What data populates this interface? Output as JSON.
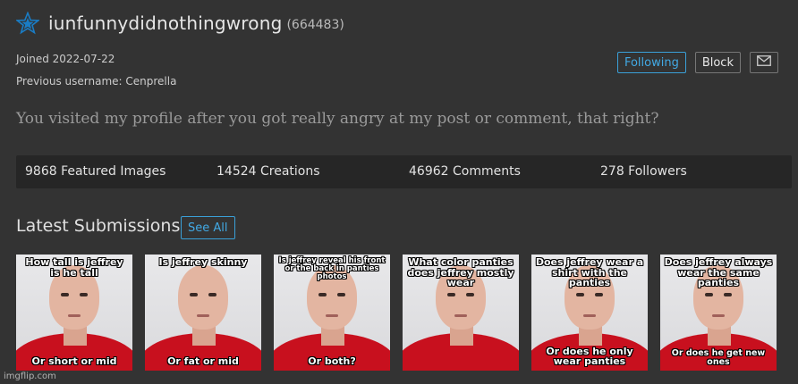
{
  "profile": {
    "username": "iunfunnydidnothingwrong",
    "user_id": "(664483)",
    "joined": "Joined 2022-07-22",
    "previous_username": "Previous username: Cenprella",
    "bio": "You visited my profile after you got really angry at my post or comment, that right?",
    "star_icon": "star-icon",
    "star_color": "#1a7cc4"
  },
  "actions": {
    "following_label": "Following",
    "block_label": "Block",
    "message_icon": "envelope-icon",
    "accent_color": "#42a9e4"
  },
  "stats": {
    "featured": "9868 Featured Images",
    "creations": "14524 Creations",
    "comments": "46962 Comments",
    "followers": "278 Followers"
  },
  "latest": {
    "title": "Latest Submissions",
    "see_all_label": "See All",
    "items": [
      {
        "top": "How tall is jeffrey is he tall",
        "bottom": "Or short or mid"
      },
      {
        "top": "Is jeffrey skinny",
        "bottom": "Or fat or mid"
      },
      {
        "top": "Is jeffrey reveal his front or the back in panties photos",
        "bottom": "Or both?"
      },
      {
        "top": "What color panties does jeffrey mostly wear",
        "bottom": ""
      },
      {
        "top": "Does jeffrey wear a shirt with the panties",
        "bottom": "Or does he only wear panties"
      },
      {
        "top": "Does jeffrey always wear the same panties",
        "bottom": "Or does he get new ones"
      }
    ]
  },
  "watermark": "imgflip.com"
}
